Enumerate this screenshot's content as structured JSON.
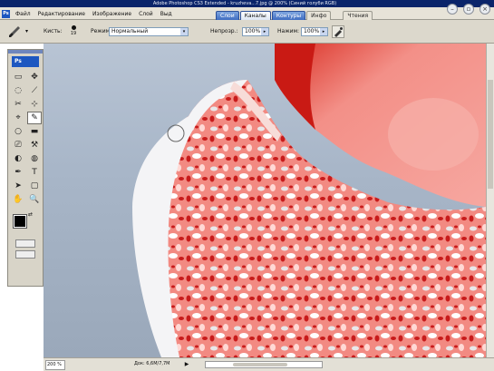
{
  "window": {
    "title": "Adobe Photoshop CS3 Extended - kruzheva...7.jpg @ 200% (Синий голуби RGB)"
  },
  "menu": {
    "items": [
      "Файл",
      "Редактирование",
      "Изображение",
      "Слой",
      "Выд"
    ]
  },
  "panel_tabs": [
    "Слои",
    "Каналы",
    "Контуры",
    "Инфо"
  ],
  "panel_tail": "Чтения",
  "options": {
    "brush_label": "Кисть:",
    "brush_size": "19",
    "mode_label": "Режим:",
    "mode_value": "Нормальный",
    "opacity_label": "Непрозр.:",
    "opacity_value": "100%",
    "flow_label": "Нажим:",
    "flow_value": "100%"
  },
  "toolbox": {
    "badge": "Ps",
    "tools": [
      "▭",
      "✥",
      "◌",
      "⟋",
      "✂",
      "⊹",
      "⌖",
      "✎",
      "○",
      "▬",
      "⎚",
      "⚒",
      "◐",
      "◍",
      "✒",
      "T",
      "➤",
      "▢",
      "✋",
      "🔍"
    ]
  },
  "status": {
    "zoom": "200 %",
    "doc_info": "Док: 6,6M/7,7M",
    "arrow": "▶"
  },
  "colors": {
    "menubar": "#e7e3d8",
    "mask_red": "#e8504a",
    "accent_blue": "#1d57c0"
  }
}
